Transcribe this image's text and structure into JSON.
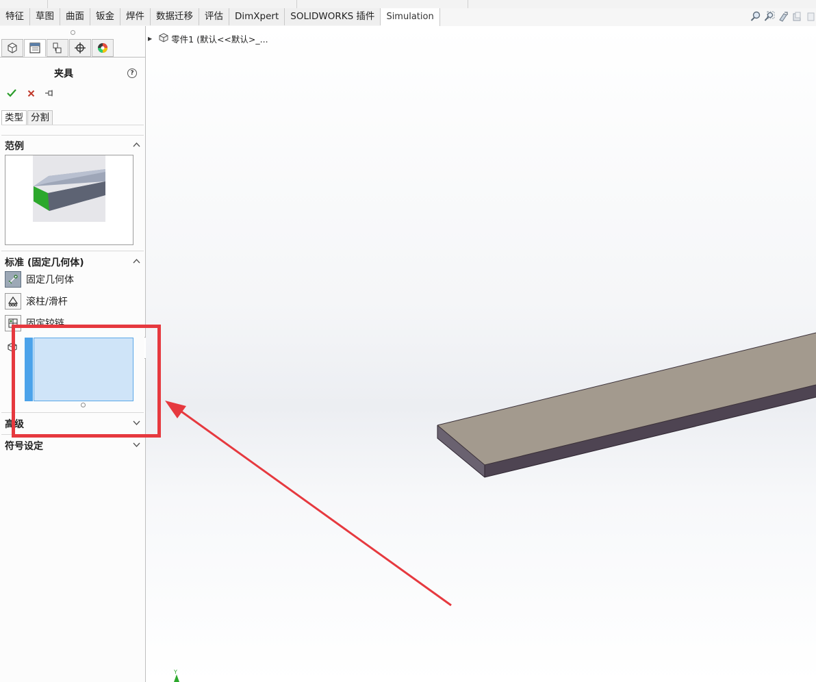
{
  "tabs": [
    {
      "label": "特征"
    },
    {
      "label": "草图"
    },
    {
      "label": "曲面"
    },
    {
      "label": "钣金"
    },
    {
      "label": "焊件"
    },
    {
      "label": "数据迁移"
    },
    {
      "label": "评估"
    },
    {
      "label": "DimXpert"
    },
    {
      "label": "SOLIDWORKS 插件"
    },
    {
      "label": "Simulation"
    }
  ],
  "active_tab_index": 9,
  "view_toolbar_icons": [
    "zoom-to-fit-icon",
    "zoom-to-area-icon",
    "previous-view-icon",
    "section-view-icon",
    "view-orientation-icon"
  ],
  "panel_tabs_icons": [
    "feature-manager-icon",
    "property-manager-icon",
    "configuration-manager-icon",
    "dimxpert-manager-icon",
    "display-manager-icon"
  ],
  "property_manager": {
    "title": "夹具",
    "help_label": "?",
    "ok_icon": "checkmark-icon",
    "cancel_icon": "x-icon",
    "pin_icon": "pushpin-icon",
    "subtabs": [
      "类型",
      "分割"
    ],
    "sections": {
      "example": "范例",
      "standard": "标准 (固定几何体)",
      "advanced": "高级",
      "symbol": "符号设定"
    },
    "options": [
      {
        "label": "固定几何体",
        "icon": "fixed-geometry-icon",
        "selected": true
      },
      {
        "label": "滚柱/滑杆",
        "icon": "roller-slider-icon",
        "selected": false
      },
      {
        "label": "固定铰链",
        "icon": "fixed-hinge-icon",
        "selected": false
      }
    ],
    "selection_box_icon": "face-selection-icon"
  },
  "tree": {
    "item": "零件1 (默认<<默认>_..."
  },
  "colors": {
    "highlight": "#e6393f",
    "selection_field": "#cfe4f8",
    "selection_bar": "#4ca3ea",
    "part_top": "#a39a8e",
    "part_side": "#4e4452"
  }
}
